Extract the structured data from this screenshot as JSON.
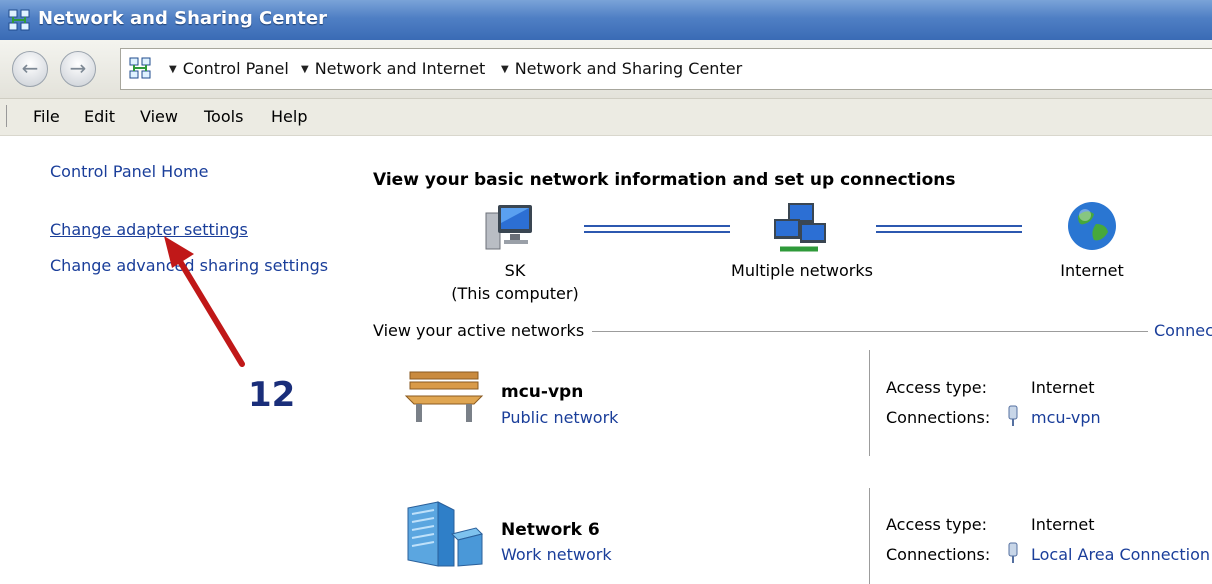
{
  "window": {
    "title": "Network and Sharing Center"
  },
  "address_bar": {
    "crumbs": [
      "Control Panel",
      "Network and Internet",
      "Network and Sharing Center"
    ]
  },
  "menu": [
    "File",
    "Edit",
    "View",
    "Tools",
    "Help"
  ],
  "left_pane": {
    "home": "Control Panel Home",
    "links": [
      "Change adapter settings",
      "Change advanced sharing settings"
    ]
  },
  "main": {
    "heading": "View your basic network information and set up connections",
    "map": {
      "computer": {
        "name": "SK",
        "sub": "(This computer)"
      },
      "middle": "Multiple networks",
      "internet": "Internet"
    },
    "active_label": "View your active networks",
    "active_link_partial": "Connec",
    "networks": [
      {
        "name": "mcu-vpn",
        "type": "Public network",
        "access_label": "Access type:",
        "access": "Internet",
        "conn_label": "Connections:",
        "conn": "mcu-vpn"
      },
      {
        "name": "Network  6",
        "type": "Work network",
        "access_label": "Access type:",
        "access": "Internet",
        "conn_label": "Connections:",
        "conn": "Local Area Connection"
      }
    ]
  },
  "annotation": {
    "step": "12",
    "color": "#c01818"
  },
  "colors": {
    "link": "#1a3e9a",
    "titlebar": "#4f7fc4",
    "wire": "#2c58b0"
  }
}
